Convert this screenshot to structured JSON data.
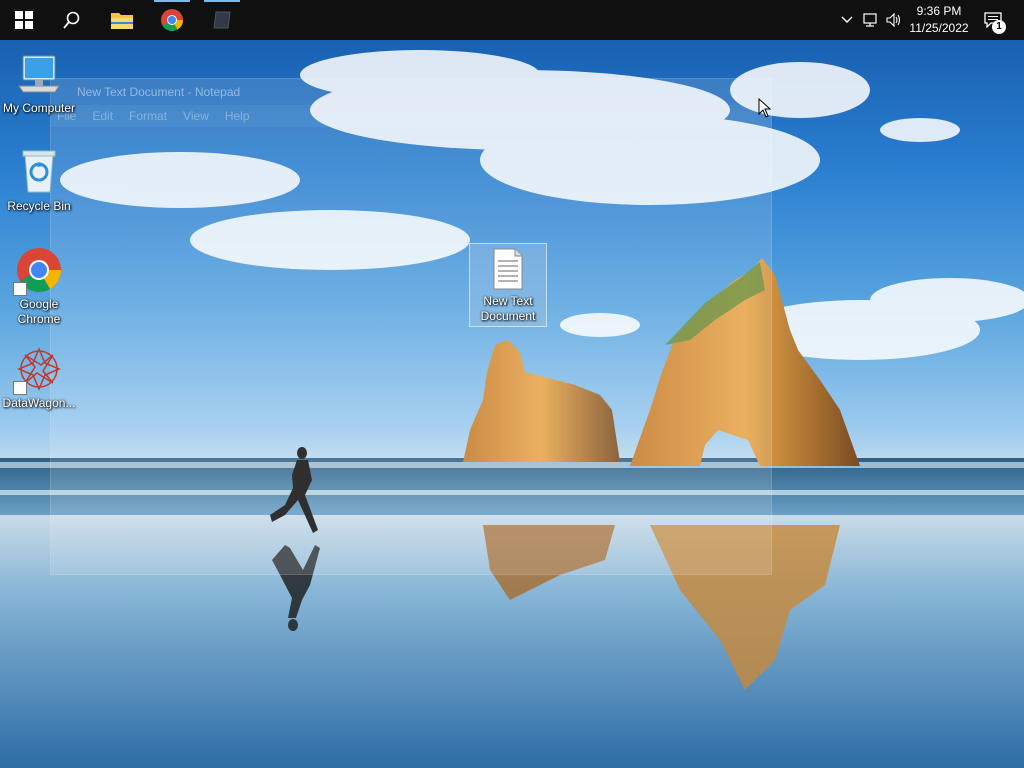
{
  "taskbar": {
    "start": "windows-start",
    "search": "search",
    "pinned": [
      {
        "name": "file-explorer",
        "active": false
      },
      {
        "name": "chrome",
        "active": true
      },
      {
        "name": "notepad",
        "active": true
      }
    ],
    "clock": {
      "time": "9:36 PM",
      "date": "11/25/2022"
    },
    "notification_count": "1"
  },
  "desktop_icons": [
    {
      "label": "My Computer",
      "icon": "computer-icon"
    },
    {
      "label": "Recycle Bin",
      "icon": "recycle-bin-icon"
    },
    {
      "label": "Google Chrome",
      "icon": "chrome-icon",
      "shortcut": true
    },
    {
      "label": "DataWagon...",
      "icon": "datawagon-icon",
      "shortcut": true
    }
  ],
  "ghost_window": {
    "title": "New Text Document - Notepad",
    "menu": [
      "File",
      "Edit",
      "Format",
      "View",
      "Help"
    ]
  },
  "dragged_file": {
    "label": "New Text Document"
  }
}
